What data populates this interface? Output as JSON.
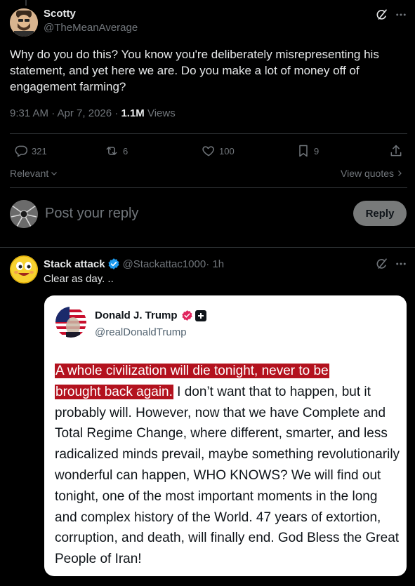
{
  "main_post": {
    "author_name": "Scotty",
    "author_handle": "@TheMeanAverage",
    "text": "Why do you do this? You know you're deliberately misrepresenting his statement, and yet here we are. Do you make a lot of money off of engagement farming?",
    "time": "9:31 AM · Apr 7, 2026 · ",
    "views_count": "1.1M",
    "views_label": " Views",
    "replies": "321",
    "reposts": "6",
    "likes": "100",
    "bookmarks": "9"
  },
  "filters": {
    "sort_label": "Relevant",
    "view_quotes_label": "View quotes"
  },
  "composer": {
    "placeholder": "Post your reply",
    "reply_button": "Reply"
  },
  "reply_post": {
    "author_name": "Stack attack",
    "author_handle": "@Stackattac1000",
    "time": " · 1h",
    "text": "Clear as day. ..",
    "quoted": {
      "name": "Donald J. Trump",
      "handle": "@realDonaldTrump",
      "highlight_1": "A whole civilization will die tonight, never to be",
      "highlight_2": "brought back again.",
      "body_line_2_rest": " I don’t want that to happen, but it",
      "body_rest": "probably will. However, now that we have Complete and Total Regime Change, where different, smarter, and less radicalized minds prevail, maybe something revolutionarily wonderful can happen, WHO KNOWS? We will find out tonight, one of the most important moments in the long and complex history of the World. 47 years of extortion, corruption, and death, will finally end. God Bless the Great People of Iran!"
    }
  },
  "icons": {
    "grok": "grok-icon",
    "more": "more-icon",
    "reply": "reply-icon",
    "repost": "repost-icon",
    "like": "like-icon",
    "bookmark": "bookmark-icon",
    "share": "share-icon",
    "verified": "verified-badge-icon"
  },
  "colors": {
    "background": "#000000",
    "text": "#e7e9ea",
    "muted": "#71767b",
    "verified_blue": "#1d9bf0",
    "highlight_red": "#b3121e",
    "reply_button_bg": "#787a7a"
  }
}
